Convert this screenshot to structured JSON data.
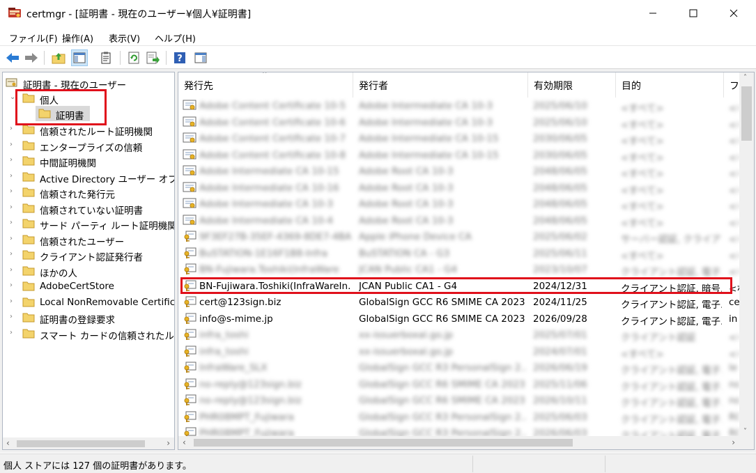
{
  "window": {
    "title": "certmgr - [証明書 - 現在のユーザー¥個人¥証明書]",
    "minimize_icon": "minimize-icon",
    "maximize_icon": "maximize-icon",
    "close_icon": "close-icon"
  },
  "menu": [
    "ファイル(F)",
    "操作(A)",
    "表示(V)",
    "ヘルプ(H)"
  ],
  "tree": {
    "root": "証明書 - 現在のユーザー",
    "personal": "個人",
    "certificates": "証明書",
    "items": [
      "信頼されたルート証明機関",
      "エンタープライズの信頼",
      "中間証明機関",
      "Active Directory ユーザー オブジェクト",
      "信頼された発行元",
      "信頼されていない証明書",
      "サード パーティ ルート証明機関",
      "信頼されたユーザー",
      "クライアント認証発行者",
      "ほかの人",
      "AdobeCertStore",
      "Local NonRemovable Certificates",
      "証明書の登録要求",
      "スマート カードの信頼されたルート"
    ]
  },
  "columns": [
    "発行先",
    "発行者",
    "有効期限",
    "目的",
    "フレンドリ名"
  ],
  "rows": [
    {
      "issued_to": "Adobe Content Certificate 10-5",
      "issuer": "Adobe Intermediate CA 10-3",
      "expires": "2025/06/10",
      "purpose": "<すべて>",
      "friendly": "<なし>",
      "blurred": true,
      "icon": "certificate-icon"
    },
    {
      "issued_to": "Adobe Content Certificate 10-6",
      "issuer": "Adobe Intermediate CA 10-3",
      "expires": "2025/06/10",
      "purpose": "<すべて>",
      "friendly": "<なし>",
      "blurred": true,
      "icon": "certificate-icon"
    },
    {
      "issued_to": "Adobe Content Certificate 10-7",
      "issuer": "Adobe Intermediate CA 10-15",
      "expires": "2030/06/05",
      "purpose": "<すべて>",
      "friendly": "<なし>",
      "blurred": true,
      "icon": "certificate-icon"
    },
    {
      "issued_to": "Adobe Content Certificate 10-8",
      "issuer": "Adobe Intermediate CA 10-15",
      "expires": "2030/06/05",
      "purpose": "<すべて>",
      "friendly": "<なし>",
      "blurred": true,
      "icon": "certificate-icon"
    },
    {
      "issued_to": "Adobe Intermediate CA 10-15",
      "issuer": "Adobe Root CA 10-3",
      "expires": "2048/06/05",
      "purpose": "<すべて>",
      "friendly": "<なし>",
      "blurred": true,
      "icon": "certificate-icon"
    },
    {
      "issued_to": "Adobe Intermediate CA 10-16",
      "issuer": "Adobe Root CA 10-3",
      "expires": "2048/06/05",
      "purpose": "<すべて>",
      "friendly": "<なし>",
      "blurred": true,
      "icon": "certificate-icon"
    },
    {
      "issued_to": "Adobe Intermediate CA 10-3",
      "issuer": "Adobe Root CA 10-3",
      "expires": "2048/06/05",
      "purpose": "<すべて>",
      "friendly": "<なし>",
      "blurred": true,
      "icon": "certificate-icon"
    },
    {
      "issued_to": "Adobe Intermediate CA 10-4",
      "issuer": "Adobe Root CA 10-3",
      "expires": "2048/06/05",
      "purpose": "<すべて>",
      "friendly": "<なし>",
      "blurred": true,
      "icon": "certificate-icon"
    },
    {
      "issued_to": "9F3EF27B-35EF-4369-8DE7-4BAL",
      "issuer": "Apple iPhone Device CA",
      "expires": "2025/06/02",
      "purpose": "サーバー認証, クライアン...",
      "friendly": "<なし>",
      "blurred": true,
      "icon": "certificate-key-icon"
    },
    {
      "issued_to": "BuSTATION-1E16F1B8-Infra",
      "issuer": "BuSTATION CA - G3",
      "expires": "2025/06/11",
      "purpose": "<すべて>",
      "friendly": "<なし>",
      "blurred": true,
      "icon": "certificate-key-icon"
    },
    {
      "issued_to": "BN-Fujiwara.Toshiki(InfraWare",
      "issuer": "JCAN Public CA1 - G4",
      "expires": "2023/10/07",
      "purpose": "クライアント認証, 電子...",
      "friendly": "<なし>",
      "blurred": true,
      "icon": "certificate-key-icon"
    },
    {
      "issued_to": "BN-Fujiwara.Toshiki(InfraWareIn...",
      "issuer": "JCAN Public CA1 - G4",
      "expires": "2024/12/31",
      "purpose": "クライアント認証, 暗号...",
      "friendly": "<な",
      "blurred": false,
      "icon": "certificate-key-icon"
    },
    {
      "issued_to": "cert@123sign.biz",
      "issuer": "GlobalSign GCC R6 SMIME CA 2023",
      "expires": "2024/11/25",
      "purpose": "クライアント認証, 電子...",
      "friendly": "ce",
      "blurred": false,
      "icon": "certificate-key-icon"
    },
    {
      "issued_to": "info@s-mime.jp",
      "issuer": "GlobalSign GCC R6 SMIME CA 2023",
      "expires": "2026/09/28",
      "purpose": "クライアント認証, 電子...",
      "friendly": "in",
      "blurred": false,
      "icon": "certificate-key-icon"
    },
    {
      "issued_to": "infra_toshi",
      "issuer": "xx-issuerboxal.go.jp",
      "expires": "2025/07/01",
      "purpose": "クライアント認証",
      "friendly": "<な",
      "blurred": true,
      "icon": "certificate-key-icon"
    },
    {
      "issued_to": "infra_toshi",
      "issuer": "xx-issuerboxal.go.jp",
      "expires": "2024/07/01",
      "purpose": "<すべて>",
      "friendly": "<な",
      "blurred": true,
      "icon": "certificate-key-icon"
    },
    {
      "issued_to": "InfraWare_SLX",
      "issuer": "GlobalSign GCC R3 PersonalSign 2...",
      "expires": "2026/06/19",
      "purpose": "クライアント認証, 電子...",
      "friendly": "le",
      "blurred": true,
      "icon": "certificate-key-icon"
    },
    {
      "issued_to": "no-reply@123sign.biz",
      "issuer": "GlobalSign GCC R6 SMIME CA 2023",
      "expires": "2025/11/06",
      "purpose": "クライアント認証, 電子...",
      "friendly": "no",
      "blurred": true,
      "icon": "certificate-key-icon"
    },
    {
      "issued_to": "no-reply@123sign.biz",
      "issuer": "GlobalSign GCC R6 SMIME CA 2023",
      "expires": "2026/10/11",
      "purpose": "クライアント認証, 電子...",
      "friendly": "no",
      "blurred": true,
      "icon": "certificate-key-icon"
    },
    {
      "issued_to": "PHR08MPT_Fujiwara",
      "issuer": "GlobalSign GCC R3 PersonalSign 2...",
      "expires": "2025/06/03",
      "purpose": "クライアント認証, 電子...",
      "friendly": "R0",
      "blurred": true,
      "icon": "certificate-key-icon"
    },
    {
      "issued_to": "PHR08MPT_Fujiwara",
      "issuer": "GlobalSign GCC R3 PersonalSign 2...",
      "expires": "2026/06/03",
      "purpose": "クライアント認証, 電子...",
      "friendly": "R0",
      "blurred": true,
      "icon": "certificate-key-icon"
    }
  ],
  "status": "個人 ストアには 127 個の証明書があります。",
  "colors": {
    "highlight": "#e0101b",
    "folder": "#f3d36b",
    "border": "#aeb6c2"
  }
}
